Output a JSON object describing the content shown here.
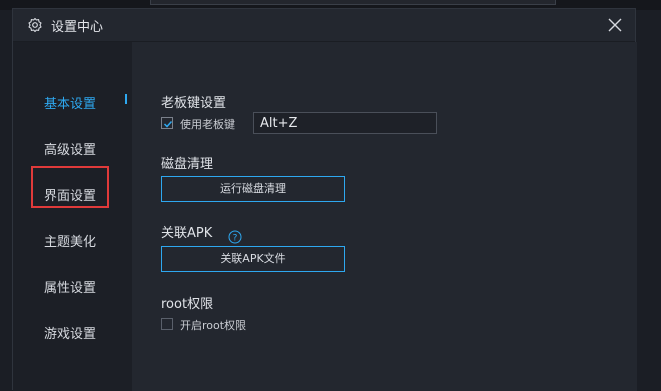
{
  "window": {
    "title": "设置中心",
    "title_icon": "gear-icon",
    "close_icon": "close-icon"
  },
  "sidebar": {
    "items": [
      {
        "label": "基本设置",
        "active": true
      },
      {
        "label": "高级设置",
        "active": false
      },
      {
        "label": "界面设置",
        "active": false,
        "highlighted": true
      },
      {
        "label": "主题美化",
        "active": false
      },
      {
        "label": "属性设置",
        "active": false
      },
      {
        "label": "游戏设置",
        "active": false
      }
    ]
  },
  "boss_key": {
    "section_title": "老板键设置",
    "checkbox_label": "使用老板键",
    "checked": true,
    "value": "Alt+Z"
  },
  "disk": {
    "section_title": "磁盘清理",
    "button_label": "运行磁盘清理"
  },
  "apk": {
    "section_title": "关联APK",
    "help_icon": "question-circle-icon",
    "button_label": "关联APK文件"
  },
  "root": {
    "section_title": "root权限",
    "checkbox_label": "开启root权限",
    "checked": false
  },
  "colors": {
    "accent": "#2ea8f0",
    "highlight_border": "#e03a3a",
    "dialog_bg": "#23272f",
    "sidebar_bg": "#1c1f26"
  }
}
